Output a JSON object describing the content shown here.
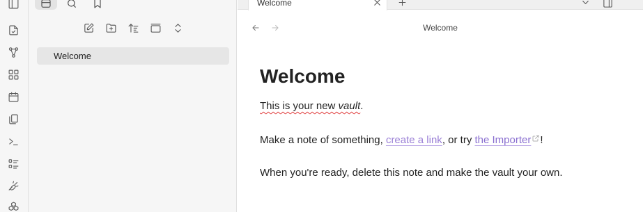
{
  "ribbon": {
    "top_icon": "sidebar-toggle-icon",
    "items": [
      {
        "icon": "switcher-icon"
      },
      {
        "icon": "graph-icon"
      },
      {
        "icon": "canvas-icon"
      },
      {
        "icon": "daily-note-icon"
      },
      {
        "icon": "templates-icon"
      },
      {
        "icon": "command-palette-icon"
      },
      {
        "icon": "bases-icon"
      },
      {
        "icon": "publish-icon"
      },
      {
        "icon": "plugins-icon"
      }
    ]
  },
  "sidebar": {
    "tabs": [
      {
        "icon": "folder-icon",
        "active": true
      },
      {
        "icon": "search-icon",
        "active": false
      },
      {
        "icon": "bookmark-icon",
        "active": false
      }
    ],
    "nav_actions": [
      {
        "icon": "new-note-icon"
      },
      {
        "icon": "new-folder-icon"
      },
      {
        "icon": "sort-icon"
      },
      {
        "icon": "collapse-icon"
      },
      {
        "icon": "expand-collapse-icon"
      }
    ],
    "files": [
      {
        "name": "Welcome",
        "active": true
      }
    ]
  },
  "tabs": [
    {
      "title": "Welcome",
      "active": true
    }
  ],
  "view": {
    "title": "Welcome"
  },
  "note": {
    "title": "Welcome",
    "p1": {
      "a": "This is your new ",
      "b": "vault",
      "c": "."
    },
    "p2": {
      "a": "Make a note of something, ",
      "link1": "create a link",
      "b": ", or try ",
      "link2": "the Importer",
      "c": "!"
    },
    "p3": "When you're ready, delete this note and make the vault your own."
  },
  "colors": {
    "accent": "#8a6fd0",
    "spellcheck": "#e03c3c",
    "sidebar_bg": "#f6f6f6"
  }
}
